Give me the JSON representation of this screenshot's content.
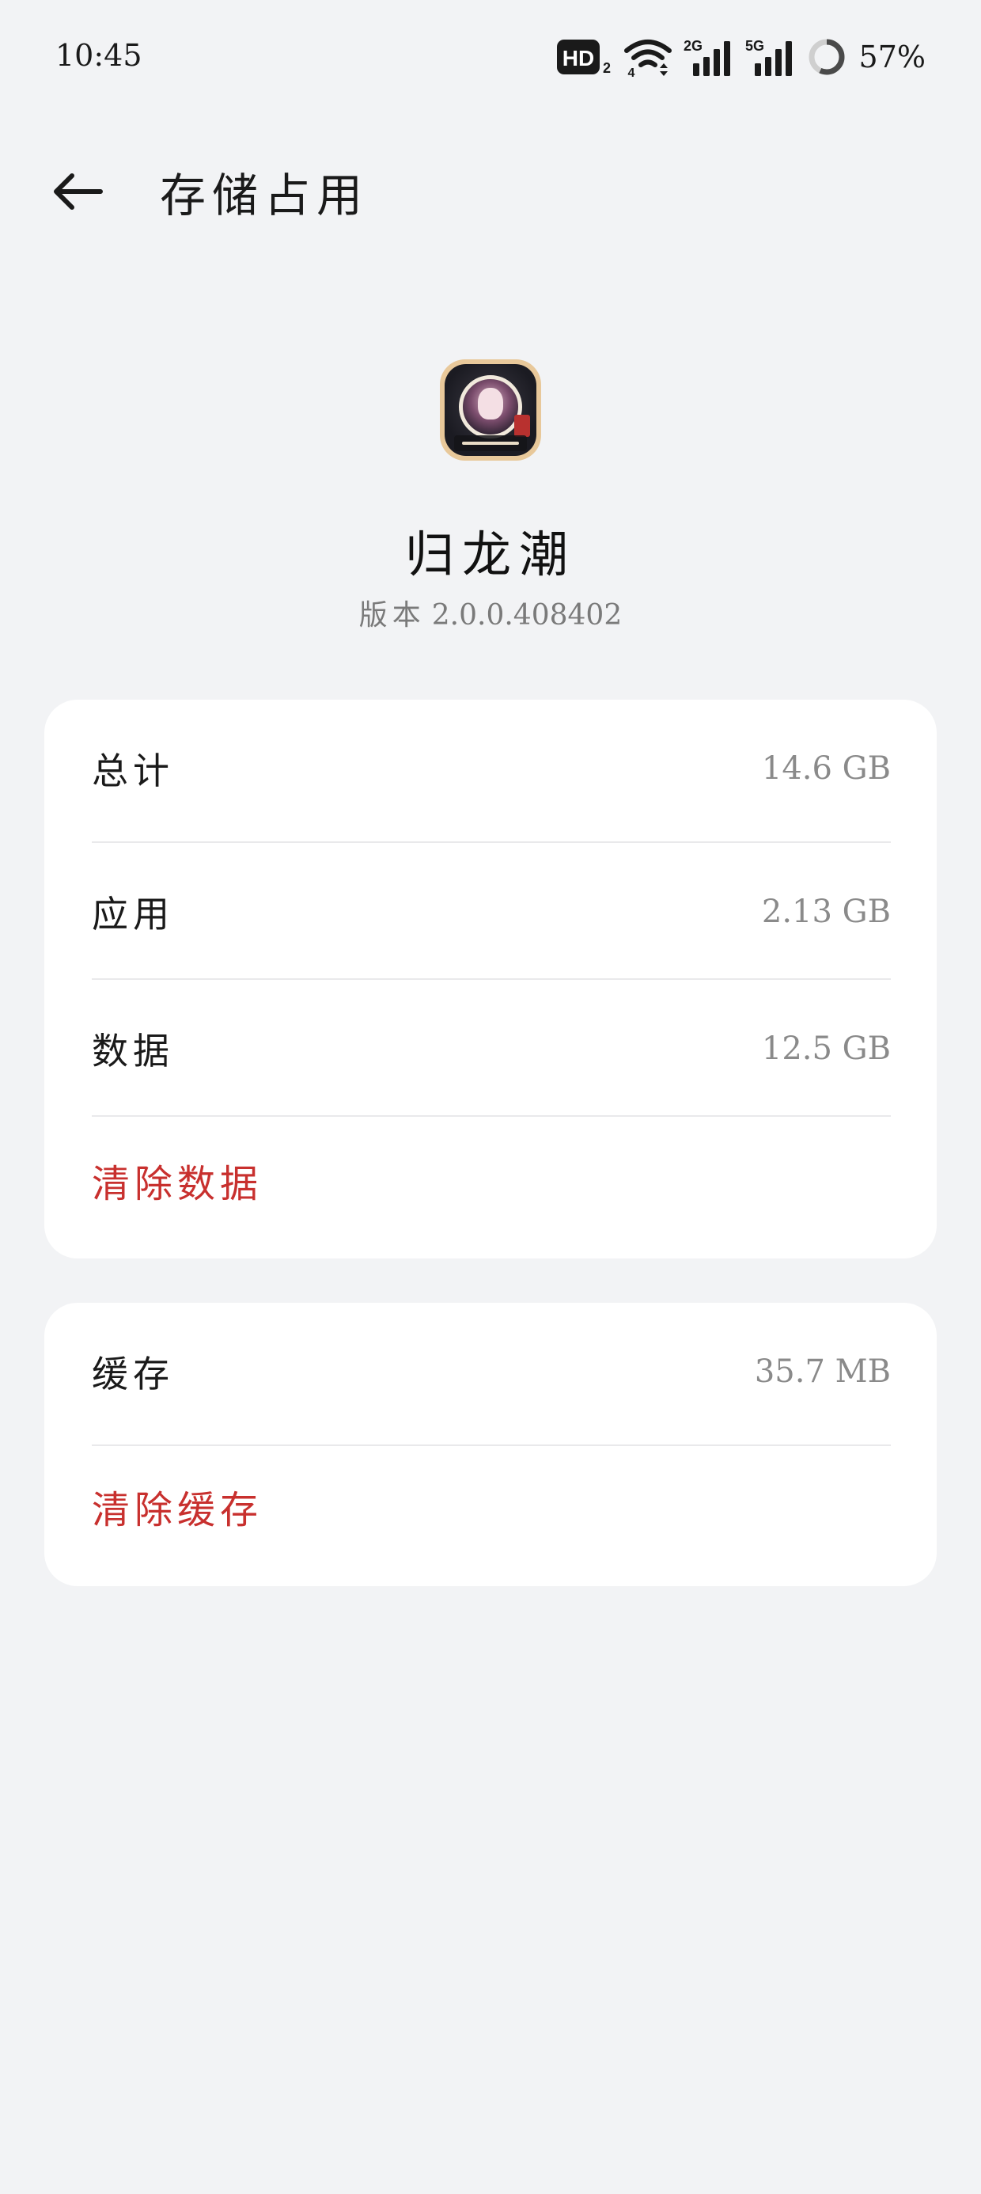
{
  "status_bar": {
    "time": "10:45",
    "hd_label": "HD",
    "hd_sub": "2",
    "wifi_sub": "4",
    "signal1_label": "2G",
    "signal2_label": "5G",
    "battery_percent": "57%",
    "battery_level": 0.57
  },
  "header": {
    "title": "存储占用"
  },
  "app": {
    "name": "归龙潮",
    "version_label": "版本",
    "version": "2.0.0.408402"
  },
  "storage": {
    "rows": [
      {
        "label": "总计",
        "value": "14.6 GB"
      },
      {
        "label": "应用",
        "value": "2.13 GB"
      },
      {
        "label": "数据",
        "value": "12.5 GB"
      }
    ],
    "clear_data_label": "清除数据"
  },
  "cache": {
    "label": "缓存",
    "value": "35.7 MB",
    "clear_cache_label": "清除缓存"
  },
  "colors": {
    "background": "#f2f3f5",
    "card": "#ffffff",
    "accent_red": "#c8302e",
    "secondary_text": "#8a8a8a"
  },
  "icons": {
    "back": "arrow-left-icon",
    "hd": "hd-icon",
    "wifi": "wifi-icon",
    "signal": "signal-bars-icon",
    "battery": "battery-ring-icon"
  }
}
